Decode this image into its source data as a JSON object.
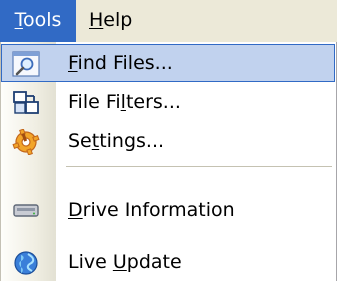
{
  "menubar": {
    "tools": {
      "pre": "",
      "key": "T",
      "post": "ools"
    },
    "help": {
      "pre": "",
      "key": "H",
      "post": "elp"
    }
  },
  "menu": {
    "items": [
      {
        "pre": "",
        "key": "F",
        "post": "ind Files...",
        "icon": "find-files-icon",
        "highlighted": true
      },
      {
        "pre": "File Fi",
        "key": "l",
        "post": "ters...",
        "icon": "file-filters-icon"
      },
      {
        "pre": "Se",
        "key": "t",
        "post": "tings...",
        "icon": "settings-icon"
      },
      {
        "pre": "",
        "key": "D",
        "post": "rive Information",
        "icon": "drive-icon"
      },
      {
        "pre": "Live ",
        "key": "U",
        "post": "pdate",
        "icon": "globe-icon"
      }
    ]
  },
  "colors": {
    "menu_highlight": "#c1d2ee",
    "menu_highlight_border": "#316ac5",
    "menubar_active": "#316ac5"
  }
}
